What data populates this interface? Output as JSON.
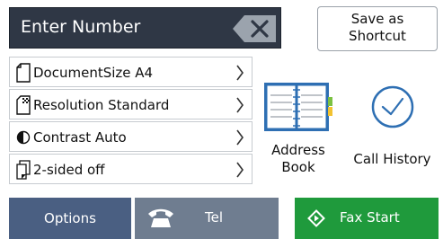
{
  "entry": {
    "placeholder": "Enter Number"
  },
  "save_shortcut": {
    "line1": "Save as",
    "line2": "Shortcut"
  },
  "settings": [
    {
      "label": "DocumentSize A4",
      "icon": "document-icon"
    },
    {
      "label": "Resolution Standard",
      "icon": "resolution-icon"
    },
    {
      "label": "Contrast Auto",
      "icon": "contrast-icon"
    },
    {
      "label": "2-sided off",
      "icon": "two-sided-icon"
    }
  ],
  "address_book": {
    "line1": "Address",
    "line2": "Book"
  },
  "call_history": {
    "label": "Call History"
  },
  "bottom": {
    "options": "Options",
    "tel": "Tel",
    "fax_start": "Fax Start"
  },
  "colors": {
    "fax_start": "#1f9a3c",
    "options": "#4a5f82",
    "tel": "#6f7d90",
    "entry_bg": "#2f3745"
  }
}
